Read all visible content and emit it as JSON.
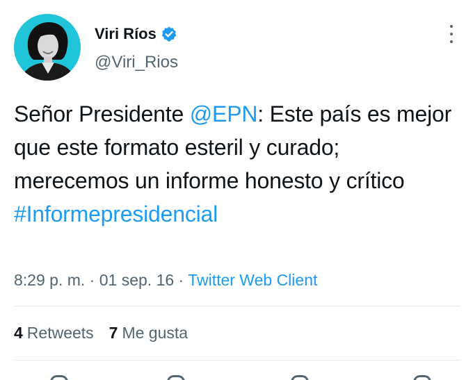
{
  "author": {
    "display_name": "Viri Ríos",
    "handle": "@Viri_Rios",
    "verified_icon": "verified-badge-icon",
    "avatar_icon": "profile-photo"
  },
  "tweet": {
    "text_part1": "Señor Presidente ",
    "mention": "@EPN",
    "text_part2": ": Este país es mejor que este formato esteril y curado; merecemos un informe honesto y crítico ",
    "hashtag": "#Informepresidencial"
  },
  "meta": {
    "time": "8:29 p. m.",
    "separator": " · ",
    "date": "01 sep. 16",
    "client": "Twitter Web Client"
  },
  "stats": {
    "retweets_count": "4",
    "retweets_label": "Retweets",
    "likes_count": "7",
    "likes_label": "Me gusta"
  },
  "colors": {
    "link": "#1d9bf0",
    "secondary_text": "#536471",
    "primary_text": "#0f1419",
    "avatar_bg": "#1fc4d9"
  }
}
